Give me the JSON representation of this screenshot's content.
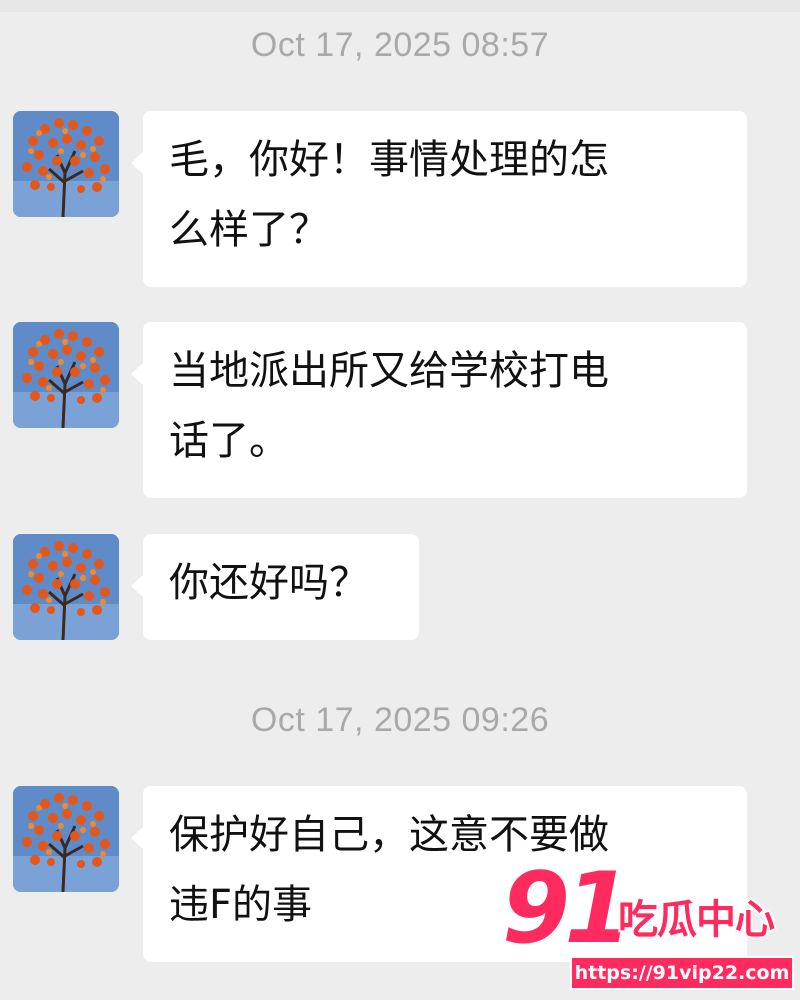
{
  "conversation": {
    "groups": [
      {
        "timestamp": "Oct 17, 2025 08:57",
        "messages": [
          {
            "lines": [
              "毛，你好！事情处理的怎",
              "么样了？"
            ]
          },
          {
            "lines": [
              "当地派出所又给学校打电",
              "话了。"
            ]
          },
          {
            "lines": [
              "你还好吗？"
            ]
          }
        ]
      },
      {
        "timestamp": "Oct 17, 2025 09:26",
        "messages": [
          {
            "lines": [
              "保护好自己，这意不要做",
              "违F的事"
            ]
          }
        ]
      }
    ],
    "avatar_icon": "persimmon-tree-avatar-icon"
  },
  "watermark": {
    "number": "91",
    "title": "吃瓜中心",
    "url": "https://91vip22.com"
  },
  "colors": {
    "background": "#ededed",
    "bubble": "#ffffff",
    "timestamp_text": "#a9a9a9",
    "watermark_accent": "#ff2a5e"
  }
}
